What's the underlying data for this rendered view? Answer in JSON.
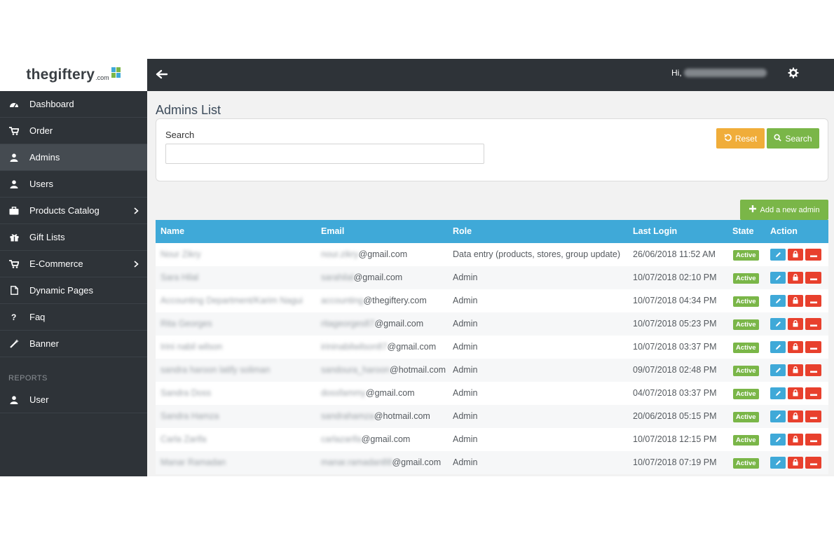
{
  "brand": {
    "logo_text": "thegiftery",
    "logo_suffix": ".com"
  },
  "sidebar": {
    "items": [
      {
        "label": "Dashboard",
        "icon": "dashboard-icon",
        "active": false,
        "has_children": false
      },
      {
        "label": "Order",
        "icon": "cart-icon",
        "active": false,
        "has_children": false
      },
      {
        "label": "Admins",
        "icon": "user-icon",
        "active": true,
        "has_children": false
      },
      {
        "label": "Users",
        "icon": "user-icon",
        "active": false,
        "has_children": false
      },
      {
        "label": "Products Catalog",
        "icon": "briefcase-icon",
        "active": false,
        "has_children": true
      },
      {
        "label": "Gift Lists",
        "icon": "gift-icon",
        "active": false,
        "has_children": false
      },
      {
        "label": "E-Commerce",
        "icon": "cart-icon",
        "active": false,
        "has_children": true
      },
      {
        "label": "Dynamic Pages",
        "icon": "file-icon",
        "active": false,
        "has_children": false
      },
      {
        "label": "Faq",
        "icon": "question-icon",
        "active": false,
        "has_children": false
      },
      {
        "label": "Banner",
        "icon": "magic-wand-icon",
        "active": false,
        "has_children": false
      }
    ],
    "reports_section": "REPORTS",
    "reports_items": [
      {
        "label": "User",
        "icon": "user-icon"
      }
    ]
  },
  "topbar": {
    "greeting_prefix": "Hi,"
  },
  "page": {
    "title": "Admins List",
    "search": {
      "label": "Search",
      "value": "",
      "placeholder": ""
    },
    "reset_label": "Reset",
    "search_label": "Search",
    "add_label": "Add a new admin"
  },
  "table": {
    "headers": {
      "name": "Name",
      "email": "Email",
      "role": "Role",
      "last_login": "Last Login",
      "state": "State",
      "action": "Action"
    },
    "rows": [
      {
        "name": "Nour Zikry",
        "email_user": "nour.zikry",
        "email_domain": "@gmail.com",
        "role": "Data entry (products, stores, group update)",
        "last_login": "26/06/2018 11:52 AM",
        "state": "Active"
      },
      {
        "name": "Sara Hilal",
        "email_user": "sarahilal",
        "email_domain": "@gmail.com",
        "role": "Admin",
        "last_login": "10/07/2018 02:10 PM",
        "state": "Active"
      },
      {
        "name": "Accounting Department/Karim Nagui",
        "email_user": "accounting",
        "email_domain": "@thegiftery.com",
        "role": "Admin",
        "last_login": "10/07/2018 04:34 PM",
        "state": "Active"
      },
      {
        "name": "Rita Georges",
        "email_user": "ritageorges87",
        "email_domain": "@gmail.com",
        "role": "Admin",
        "last_login": "10/07/2018 05:23 PM",
        "state": "Active"
      },
      {
        "name": "Irini nabil wilson",
        "email_user": "irininabilwilson87",
        "email_domain": "@gmail.com",
        "role": "Admin",
        "last_login": "10/07/2018 03:37 PM",
        "state": "Active"
      },
      {
        "name": "sandra haroon latify soliman",
        "email_user": "sandoura_haroon",
        "email_domain": "@hotmail.com",
        "role": "Admin",
        "last_login": "09/07/2018 02:48 PM",
        "state": "Active"
      },
      {
        "name": "Sandra Doss",
        "email_user": "dossfammy",
        "email_domain": "@gmail.com",
        "role": "Admin",
        "last_login": "04/07/2018 03:37 PM",
        "state": "Active"
      },
      {
        "name": "Sandra Hamza",
        "email_user": "sandrahamza",
        "email_domain": "@hotmail.com",
        "role": "Admin",
        "last_login": "20/06/2018 05:15 PM",
        "state": "Active"
      },
      {
        "name": "Carla Zarifa",
        "email_user": "carlazarifa",
        "email_domain": "@gmail.com",
        "role": "Admin",
        "last_login": "10/07/2018 12:15 PM",
        "state": "Active"
      },
      {
        "name": "Manar Ramadan",
        "email_user": "manar.ramadan88",
        "email_domain": "@gmail.com",
        "role": "Admin",
        "last_login": "10/07/2018 07:19 PM",
        "state": "Active"
      }
    ]
  },
  "colors": {
    "sidebar_bg": "#2e3338",
    "table_header": "#3fa9d8",
    "active_badge": "#7ab648",
    "reset_button": "#f0ad3a",
    "danger": "#e8402d"
  }
}
